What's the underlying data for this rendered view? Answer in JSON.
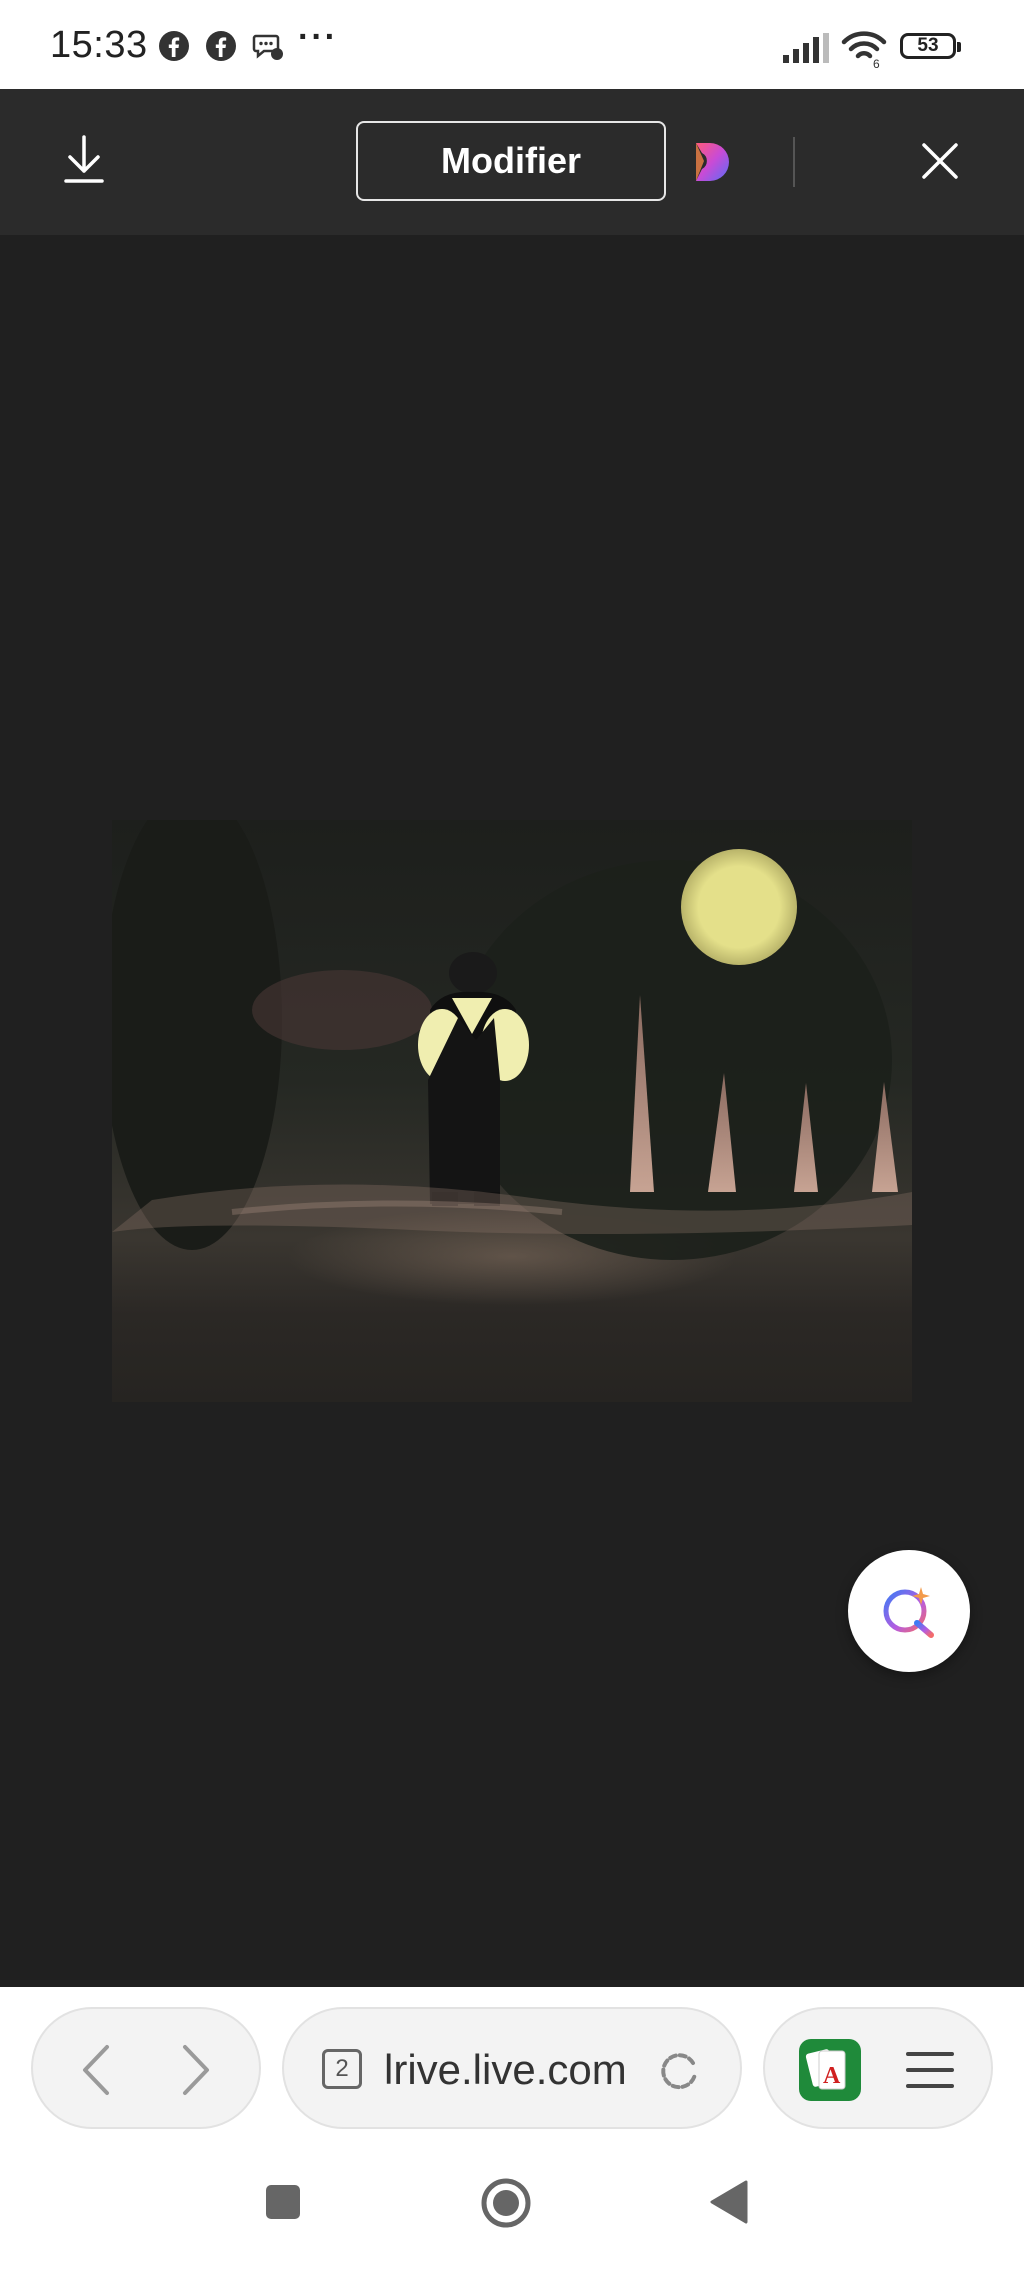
{
  "status_bar": {
    "time": "15:33",
    "notification_icons": [
      "facebook-icon",
      "facebook-icon",
      "messenger-icon"
    ],
    "more": "···",
    "battery": "53"
  },
  "toolbar": {
    "modifier_label": "Modifier",
    "icons": [
      "download-icon",
      "copilot-icon",
      "close-icon"
    ]
  },
  "browser": {
    "tab_count": "2",
    "url": "lrive.live.com",
    "icons": [
      "back-icon",
      "forward-icon",
      "reload-icon",
      "solitaire-app-icon",
      "menu-icon"
    ]
  },
  "colors": {
    "status_bg": "#ffffff",
    "toolbar_bg": "#2b2b2b",
    "viewer_bg": "#202020",
    "moon": "#e4e08a"
  }
}
